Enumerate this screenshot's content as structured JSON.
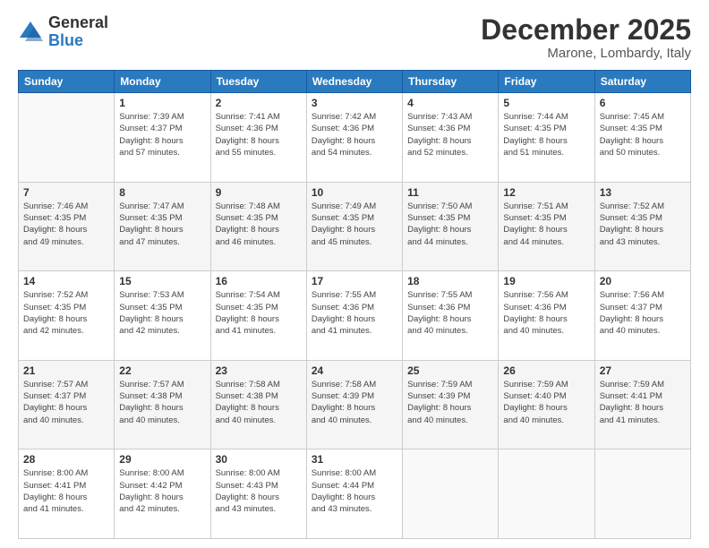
{
  "header": {
    "logo_general": "General",
    "logo_blue": "Blue",
    "month_title": "December 2025",
    "location": "Marone, Lombardy, Italy"
  },
  "weekdays": [
    "Sunday",
    "Monday",
    "Tuesday",
    "Wednesday",
    "Thursday",
    "Friday",
    "Saturday"
  ],
  "weeks": [
    [
      {
        "day": "",
        "info": ""
      },
      {
        "day": "1",
        "info": "Sunrise: 7:39 AM\nSunset: 4:37 PM\nDaylight: 8 hours\nand 57 minutes."
      },
      {
        "day": "2",
        "info": "Sunrise: 7:41 AM\nSunset: 4:36 PM\nDaylight: 8 hours\nand 55 minutes."
      },
      {
        "day": "3",
        "info": "Sunrise: 7:42 AM\nSunset: 4:36 PM\nDaylight: 8 hours\nand 54 minutes."
      },
      {
        "day": "4",
        "info": "Sunrise: 7:43 AM\nSunset: 4:36 PM\nDaylight: 8 hours\nand 52 minutes."
      },
      {
        "day": "5",
        "info": "Sunrise: 7:44 AM\nSunset: 4:35 PM\nDaylight: 8 hours\nand 51 minutes."
      },
      {
        "day": "6",
        "info": "Sunrise: 7:45 AM\nSunset: 4:35 PM\nDaylight: 8 hours\nand 50 minutes."
      }
    ],
    [
      {
        "day": "7",
        "info": "Sunrise: 7:46 AM\nSunset: 4:35 PM\nDaylight: 8 hours\nand 49 minutes."
      },
      {
        "day": "8",
        "info": "Sunrise: 7:47 AM\nSunset: 4:35 PM\nDaylight: 8 hours\nand 47 minutes."
      },
      {
        "day": "9",
        "info": "Sunrise: 7:48 AM\nSunset: 4:35 PM\nDaylight: 8 hours\nand 46 minutes."
      },
      {
        "day": "10",
        "info": "Sunrise: 7:49 AM\nSunset: 4:35 PM\nDaylight: 8 hours\nand 45 minutes."
      },
      {
        "day": "11",
        "info": "Sunrise: 7:50 AM\nSunset: 4:35 PM\nDaylight: 8 hours\nand 44 minutes."
      },
      {
        "day": "12",
        "info": "Sunrise: 7:51 AM\nSunset: 4:35 PM\nDaylight: 8 hours\nand 44 minutes."
      },
      {
        "day": "13",
        "info": "Sunrise: 7:52 AM\nSunset: 4:35 PM\nDaylight: 8 hours\nand 43 minutes."
      }
    ],
    [
      {
        "day": "14",
        "info": "Sunrise: 7:52 AM\nSunset: 4:35 PM\nDaylight: 8 hours\nand 42 minutes."
      },
      {
        "day": "15",
        "info": "Sunrise: 7:53 AM\nSunset: 4:35 PM\nDaylight: 8 hours\nand 42 minutes."
      },
      {
        "day": "16",
        "info": "Sunrise: 7:54 AM\nSunset: 4:35 PM\nDaylight: 8 hours\nand 41 minutes."
      },
      {
        "day": "17",
        "info": "Sunrise: 7:55 AM\nSunset: 4:36 PM\nDaylight: 8 hours\nand 41 minutes."
      },
      {
        "day": "18",
        "info": "Sunrise: 7:55 AM\nSunset: 4:36 PM\nDaylight: 8 hours\nand 40 minutes."
      },
      {
        "day": "19",
        "info": "Sunrise: 7:56 AM\nSunset: 4:36 PM\nDaylight: 8 hours\nand 40 minutes."
      },
      {
        "day": "20",
        "info": "Sunrise: 7:56 AM\nSunset: 4:37 PM\nDaylight: 8 hours\nand 40 minutes."
      }
    ],
    [
      {
        "day": "21",
        "info": "Sunrise: 7:57 AM\nSunset: 4:37 PM\nDaylight: 8 hours\nand 40 minutes."
      },
      {
        "day": "22",
        "info": "Sunrise: 7:57 AM\nSunset: 4:38 PM\nDaylight: 8 hours\nand 40 minutes."
      },
      {
        "day": "23",
        "info": "Sunrise: 7:58 AM\nSunset: 4:38 PM\nDaylight: 8 hours\nand 40 minutes."
      },
      {
        "day": "24",
        "info": "Sunrise: 7:58 AM\nSunset: 4:39 PM\nDaylight: 8 hours\nand 40 minutes."
      },
      {
        "day": "25",
        "info": "Sunrise: 7:59 AM\nSunset: 4:39 PM\nDaylight: 8 hours\nand 40 minutes."
      },
      {
        "day": "26",
        "info": "Sunrise: 7:59 AM\nSunset: 4:40 PM\nDaylight: 8 hours\nand 40 minutes."
      },
      {
        "day": "27",
        "info": "Sunrise: 7:59 AM\nSunset: 4:41 PM\nDaylight: 8 hours\nand 41 minutes."
      }
    ],
    [
      {
        "day": "28",
        "info": "Sunrise: 8:00 AM\nSunset: 4:41 PM\nDaylight: 8 hours\nand 41 minutes."
      },
      {
        "day": "29",
        "info": "Sunrise: 8:00 AM\nSunset: 4:42 PM\nDaylight: 8 hours\nand 42 minutes."
      },
      {
        "day": "30",
        "info": "Sunrise: 8:00 AM\nSunset: 4:43 PM\nDaylight: 8 hours\nand 43 minutes."
      },
      {
        "day": "31",
        "info": "Sunrise: 8:00 AM\nSunset: 4:44 PM\nDaylight: 8 hours\nand 43 minutes."
      },
      {
        "day": "",
        "info": ""
      },
      {
        "day": "",
        "info": ""
      },
      {
        "day": "",
        "info": ""
      }
    ]
  ]
}
